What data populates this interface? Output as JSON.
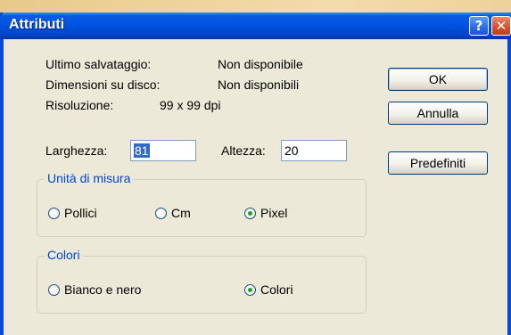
{
  "window": {
    "title": "Attributi",
    "help_label": "?",
    "close_label": "✕"
  },
  "info": {
    "last_saved_label": "Ultimo salvataggio:",
    "last_saved_value": "Non disponibile",
    "disk_size_label": "Dimensioni su disco:",
    "disk_size_value": "Non disponibili",
    "resolution_label": "Risoluzione:",
    "resolution_value": "99 x 99 dpi"
  },
  "size": {
    "width_label": "Larghezza:",
    "width_value": "81",
    "height_label": "Altezza:",
    "height_value": "20"
  },
  "units": {
    "title": "Unità di misura",
    "options": [
      "Pollici",
      "Cm",
      "Pixel"
    ],
    "selected": "Pixel"
  },
  "colors": {
    "title": "Colori",
    "options": [
      "Bianco e nero",
      "Colori"
    ],
    "selected": "Colori"
  },
  "buttons": {
    "ok": "OK",
    "cancel": "Annulla",
    "defaults": "Predefiniti"
  },
  "theme": {
    "titlebar": "#0054e3",
    "dialog_bg": "#ece9d8",
    "group_title": "#0046d5",
    "selection": "#316ac5",
    "radio_dot": "#21a121",
    "close_button": "#d4502c"
  }
}
